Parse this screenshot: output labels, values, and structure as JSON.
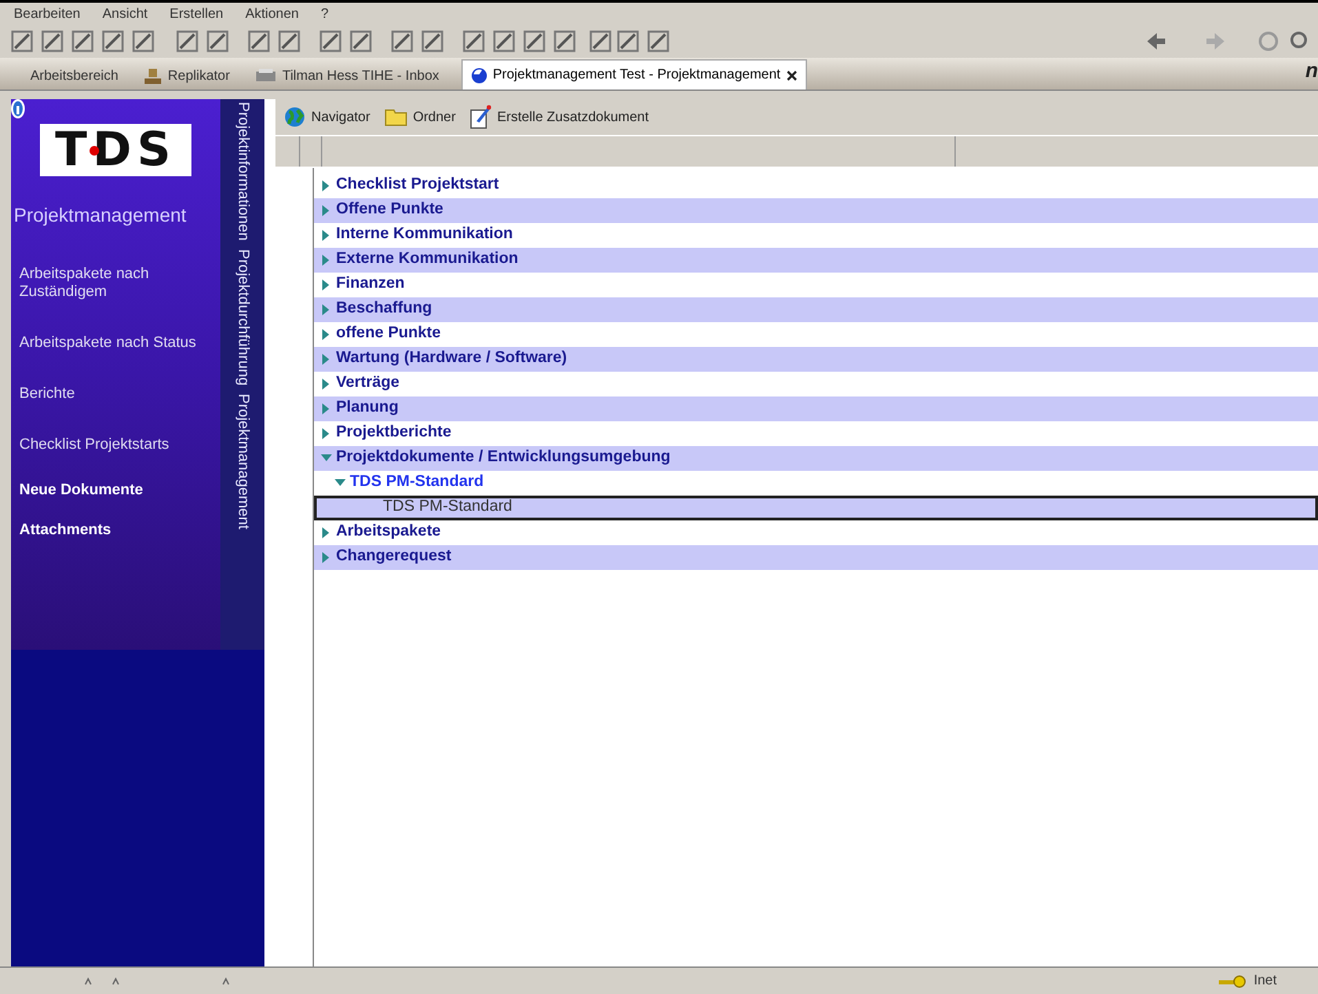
{
  "menu": [
    "Bearbeiten",
    "Ansicht",
    "Erstellen",
    "Aktionen",
    "?"
  ],
  "tabs": [
    {
      "label": "Arbeitsbereich",
      "selected": false
    },
    {
      "label": "Replikator",
      "selected": false
    },
    {
      "label": "Tilman Hess TIHE - Inbox",
      "selected": false
    },
    {
      "label": "Projektmanagement Test - Projektmanagement",
      "selected": true
    }
  ],
  "brand_corner": "n",
  "sidebar": {
    "logo": "TDS",
    "title": "Projektmanagement",
    "items": [
      {
        "label": "Arbeitspakete nach Zuständigem",
        "bold": false
      },
      {
        "label": "Arbeitspakete nach Status",
        "bold": false
      },
      {
        "label": "Berichte",
        "bold": false
      },
      {
        "label": "Checklist Projektstarts",
        "bold": false
      },
      {
        "label": "Neue Dokumente",
        "bold": true
      },
      {
        "label": "Attachments",
        "bold": true
      }
    ],
    "vertical_tabs": [
      "Projektinformationen",
      "Projektdurchführung",
      "Projektmanagement"
    ]
  },
  "action_bar": [
    "Navigator",
    "Ordner",
    "Erstelle Zusatzdokument"
  ],
  "tree": [
    {
      "label": "Checklist Projektstart",
      "expanded": false
    },
    {
      "label": "Offene Punkte",
      "expanded": false
    },
    {
      "label": "Interne Kommunikation",
      "expanded": false
    },
    {
      "label": "Externe Kommunikation",
      "expanded": false
    },
    {
      "label": "Finanzen",
      "expanded": false
    },
    {
      "label": "Beschaffung",
      "expanded": false
    },
    {
      "label": "offene Punkte",
      "expanded": false
    },
    {
      "label": "Wartung (Hardware / Software)",
      "expanded": false
    },
    {
      "label": "Verträge",
      "expanded": false
    },
    {
      "label": "Planung",
      "expanded": false
    },
    {
      "label": "Projektberichte",
      "expanded": false
    },
    {
      "label": "Projektdokumente / Entwicklungsumgebung",
      "expanded": true,
      "children": [
        {
          "label": "TDS PM-Standard",
          "expanded": true,
          "children": [
            {
              "label": "TDS PM-Standard",
              "kind": "document",
              "selected": true
            }
          ]
        }
      ]
    },
    {
      "label": "Arbeitspakete",
      "expanded": false
    },
    {
      "label": "Changerequest",
      "expanded": false
    }
  ],
  "status_bar": {
    "location": "Inet"
  }
}
